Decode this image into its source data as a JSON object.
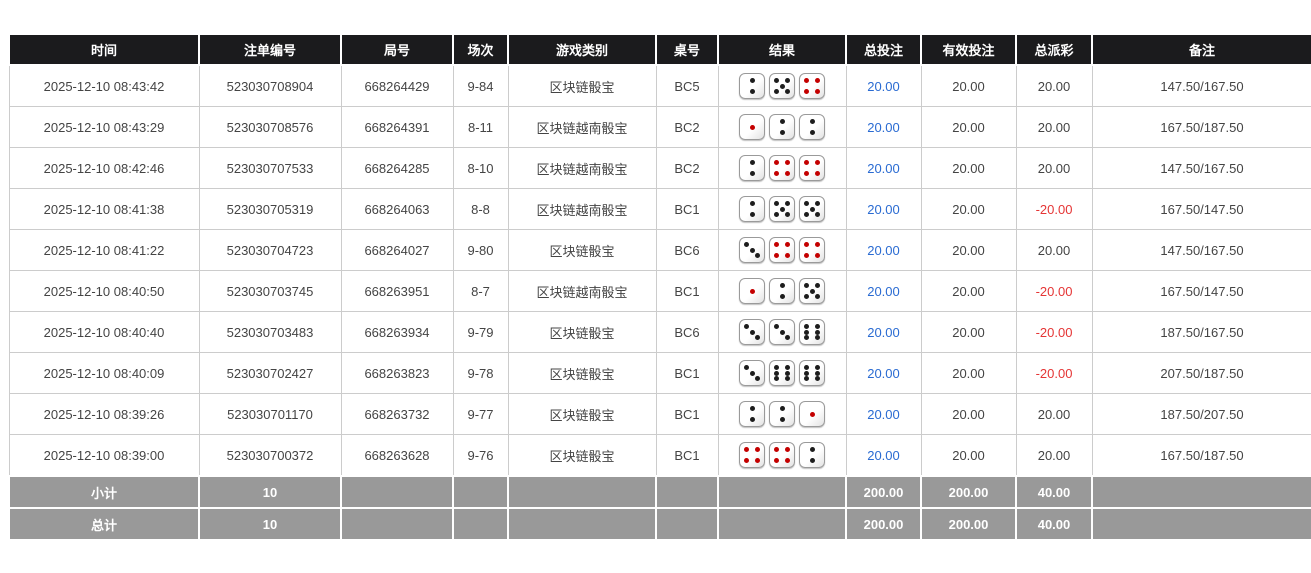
{
  "colors": {
    "header_bg": "#1b1b1d",
    "footer_bg": "#999999",
    "bet_amount_blue": "#2a6bd2",
    "negative_red": "#e53535",
    "dice_black_pip": "#1d1d1d",
    "dice_red_pip": "#c40000"
  },
  "table": {
    "headers": [
      "时间",
      "注单编号",
      "局号",
      "场次",
      "游戏类别",
      "桌号",
      "结果",
      "总投注",
      "有效投注",
      "总派彩",
      "备注"
    ],
    "rows": [
      {
        "time": "2025-12-10 08:43:42",
        "bet_id": "523030708904",
        "round_id": "668264429",
        "session": "9-84",
        "game": "区块链骰宝",
        "table_no": "BC5",
        "dice": [
          2,
          5,
          4
        ],
        "total_bet": "20.00",
        "valid_bet": "20.00",
        "payout": "20.00",
        "payout_negative": false,
        "remark": "147.50/167.50"
      },
      {
        "time": "2025-12-10 08:43:29",
        "bet_id": "523030708576",
        "round_id": "668264391",
        "session": "8-11",
        "game": "区块链越南骰宝",
        "table_no": "BC2",
        "dice": [
          1,
          2,
          2
        ],
        "total_bet": "20.00",
        "valid_bet": "20.00",
        "payout": "20.00",
        "payout_negative": false,
        "remark": "167.50/187.50"
      },
      {
        "time": "2025-12-10 08:42:46",
        "bet_id": "523030707533",
        "round_id": "668264285",
        "session": "8-10",
        "game": "区块链越南骰宝",
        "table_no": "BC2",
        "dice": [
          2,
          4,
          4
        ],
        "total_bet": "20.00",
        "valid_bet": "20.00",
        "payout": "20.00",
        "payout_negative": false,
        "remark": "147.50/167.50"
      },
      {
        "time": "2025-12-10 08:41:38",
        "bet_id": "523030705319",
        "round_id": "668264063",
        "session": "8-8",
        "game": "区块链越南骰宝",
        "table_no": "BC1",
        "dice": [
          2,
          5,
          5
        ],
        "total_bet": "20.00",
        "valid_bet": "20.00",
        "payout": "-20.00",
        "payout_negative": true,
        "remark": "167.50/147.50"
      },
      {
        "time": "2025-12-10 08:41:22",
        "bet_id": "523030704723",
        "round_id": "668264027",
        "session": "9-80",
        "game": "区块链骰宝",
        "table_no": "BC6",
        "dice": [
          3,
          4,
          4
        ],
        "total_bet": "20.00",
        "valid_bet": "20.00",
        "payout": "20.00",
        "payout_negative": false,
        "remark": "147.50/167.50"
      },
      {
        "time": "2025-12-10 08:40:50",
        "bet_id": "523030703745",
        "round_id": "668263951",
        "session": "8-7",
        "game": "区块链越南骰宝",
        "table_no": "BC1",
        "dice": [
          1,
          2,
          5
        ],
        "total_bet": "20.00",
        "valid_bet": "20.00",
        "payout": "-20.00",
        "payout_negative": true,
        "remark": "167.50/147.50"
      },
      {
        "time": "2025-12-10 08:40:40",
        "bet_id": "523030703483",
        "round_id": "668263934",
        "session": "9-79",
        "game": "区块链骰宝",
        "table_no": "BC6",
        "dice": [
          3,
          3,
          6
        ],
        "total_bet": "20.00",
        "valid_bet": "20.00",
        "payout": "-20.00",
        "payout_negative": true,
        "remark": "187.50/167.50"
      },
      {
        "time": "2025-12-10 08:40:09",
        "bet_id": "523030702427",
        "round_id": "668263823",
        "session": "9-78",
        "game": "区块链骰宝",
        "table_no": "BC1",
        "dice": [
          3,
          6,
          6
        ],
        "total_bet": "20.00",
        "valid_bet": "20.00",
        "payout": "-20.00",
        "payout_negative": true,
        "remark": "207.50/187.50"
      },
      {
        "time": "2025-12-10 08:39:26",
        "bet_id": "523030701170",
        "round_id": "668263732",
        "session": "9-77",
        "game": "区块链骰宝",
        "table_no": "BC1",
        "dice": [
          2,
          2,
          1
        ],
        "total_bet": "20.00",
        "valid_bet": "20.00",
        "payout": "20.00",
        "payout_negative": false,
        "remark": "187.50/207.50"
      },
      {
        "time": "2025-12-10 08:39:00",
        "bet_id": "523030700372",
        "round_id": "668263628",
        "session": "9-76",
        "game": "区块链骰宝",
        "table_no": "BC1",
        "dice": [
          4,
          4,
          2
        ],
        "total_bet": "20.00",
        "valid_bet": "20.00",
        "payout": "20.00",
        "payout_negative": false,
        "remark": "167.50/187.50"
      }
    ],
    "footer": [
      {
        "label": "小计",
        "count": "10",
        "total_bet": "200.00",
        "valid_bet": "200.00",
        "payout": "40.00"
      },
      {
        "label": "总计",
        "count": "10",
        "total_bet": "200.00",
        "valid_bet": "200.00",
        "payout": "40.00"
      }
    ]
  }
}
